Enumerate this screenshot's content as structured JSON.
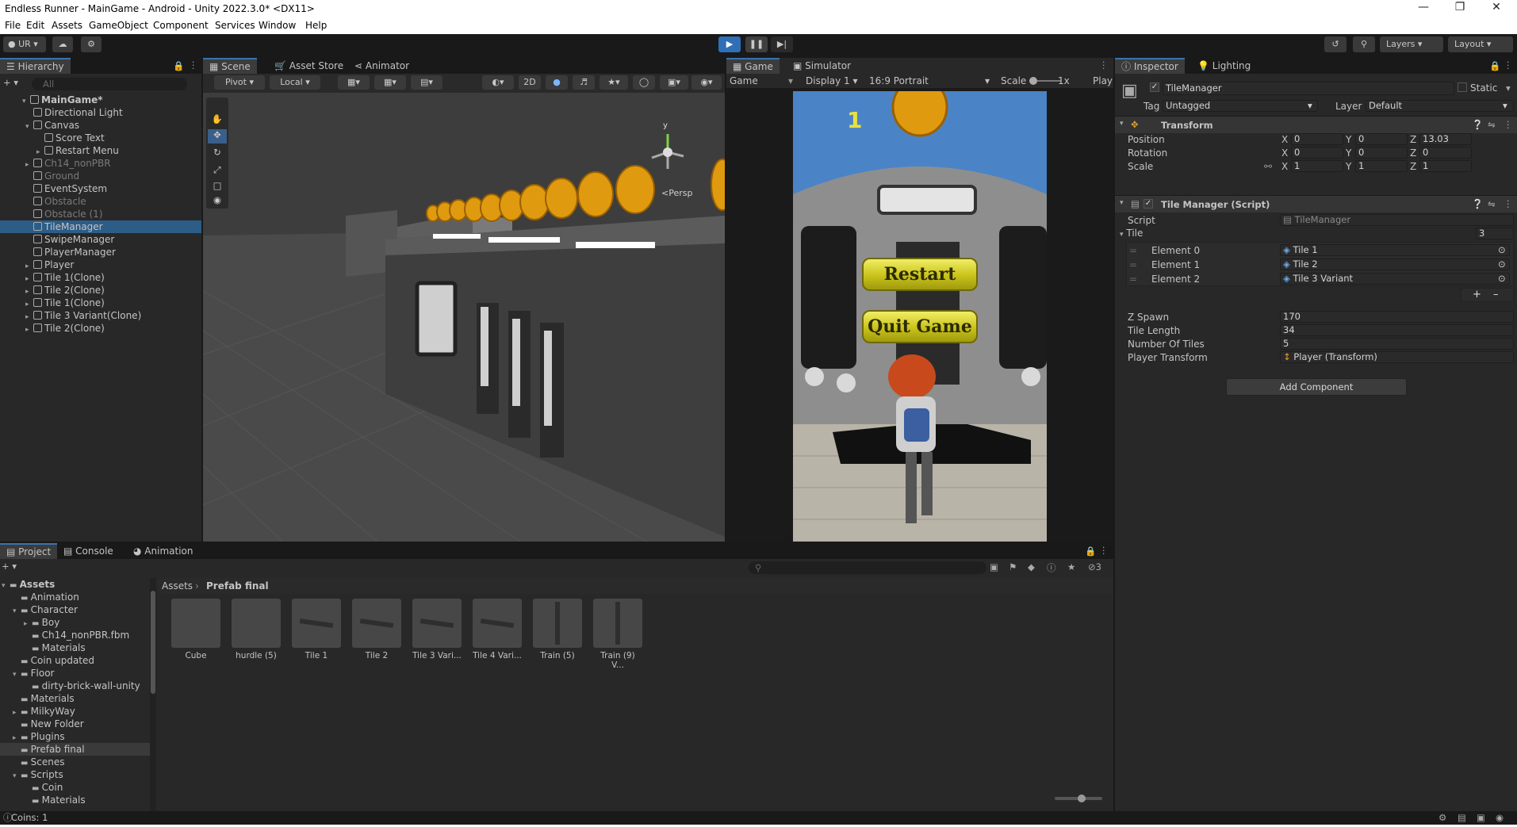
{
  "window": {
    "title": "Endless Runner - MainGame - Android - Unity 2022.3.0* <DX11>"
  },
  "menu": [
    "File",
    "Edit",
    "Assets",
    "GameObject",
    "Component",
    "Services",
    "Window",
    "Help"
  ],
  "toolbar": {
    "account": "UR",
    "layers": "Layers",
    "layout": "Layout"
  },
  "hierarchy": {
    "tab": "Hierarchy",
    "search_placeholder": "All",
    "scene": "MainGame*",
    "items": [
      {
        "label": "Directional Light",
        "dim": false
      },
      {
        "label": "Canvas",
        "dim": false
      },
      {
        "label": "Score Text",
        "dim": false
      },
      {
        "label": "Restart Menu",
        "dim": false
      },
      {
        "label": "Ch14_nonPBR",
        "dim": true
      },
      {
        "label": "Ground",
        "dim": true
      },
      {
        "label": "EventSystem",
        "dim": false
      },
      {
        "label": "Obstacle",
        "dim": true
      },
      {
        "label": "Obstacle (1)",
        "dim": true
      },
      {
        "label": "TileManager",
        "dim": false
      },
      {
        "label": "SwipeManager",
        "dim": false
      },
      {
        "label": "PlayerManager",
        "dim": false
      },
      {
        "label": "Player",
        "dim": false
      },
      {
        "label": "Tile 1(Clone)",
        "dim": false
      },
      {
        "label": "Tile 2(Clone)",
        "dim": false
      },
      {
        "label": "Tile 1(Clone)",
        "dim": false
      },
      {
        "label": "Tile 3 Variant(Clone)",
        "dim": false
      },
      {
        "label": "Tile 2(Clone)",
        "dim": false
      }
    ]
  },
  "scene_view": {
    "tabs": [
      "Scene",
      "Asset Store",
      "Animator"
    ],
    "pivot": "Pivot",
    "local": "Local",
    "mode_2d": "2D",
    "persp": "<Persp"
  },
  "game_view": {
    "tabs": [
      "Game",
      "Simulator"
    ],
    "mode": "Game",
    "display": "Display 1",
    "aspect": "16:9 Portrait",
    "scale_label": "Scale",
    "scale_value": "1x",
    "play_label": "Play",
    "score": "1",
    "restart": "Restart",
    "quit": "Quit Game"
  },
  "inspector": {
    "tabs": [
      "Inspector",
      "Lighting"
    ],
    "object_name": "TileManager",
    "static_label": "Static",
    "tag_label": "Tag",
    "tag": "Untagged",
    "layer_label": "Layer",
    "layer": "Default",
    "transform": {
      "title": "Transform",
      "position": {
        "label": "Position",
        "x": "0",
        "y": "0",
        "z": "13.03"
      },
      "rotation": {
        "label": "Rotation",
        "x": "0",
        "y": "0",
        "z": "0"
      },
      "scale": {
        "label": "Scale",
        "x": "1",
        "y": "1",
        "z": "1"
      }
    },
    "script": {
      "title": "Tile Manager (Script)",
      "script_label": "Script",
      "script_value": "TileManager",
      "tile_label": "Tile",
      "tile_count": "3",
      "elements": [
        {
          "label": "Element 0",
          "value": "Tile 1"
        },
        {
          "label": "Element 1",
          "value": "Tile 2"
        },
        {
          "label": "Element 2",
          "value": "Tile 3 Variant"
        }
      ],
      "fields": [
        {
          "label": "Z Spawn",
          "value": "170"
        },
        {
          "label": "Tile Length",
          "value": "34"
        },
        {
          "label": "Number Of Tiles",
          "value": "5"
        },
        {
          "label": "Player Transform",
          "value": "Player (Transform)"
        }
      ]
    },
    "add_component": "Add Component"
  },
  "project": {
    "tabs": [
      "Project",
      "Console",
      "Animation"
    ],
    "hidden_count": "3",
    "tree": [
      {
        "label": "Assets",
        "depth": 0,
        "bold": true
      },
      {
        "label": "Animation",
        "depth": 1
      },
      {
        "label": "Character",
        "depth": 1
      },
      {
        "label": "Boy",
        "depth": 2
      },
      {
        "label": "Ch14_nonPBR.fbm",
        "depth": 2
      },
      {
        "label": "Materials",
        "depth": 2
      },
      {
        "label": "Coin updated",
        "depth": 1
      },
      {
        "label": "Floor",
        "depth": 1
      },
      {
        "label": "dirty-brick-wall-unity",
        "depth": 2
      },
      {
        "label": "Materials",
        "depth": 1
      },
      {
        "label": "MilkyWay",
        "depth": 1
      },
      {
        "label": "New Folder",
        "depth": 1
      },
      {
        "label": "Plugins",
        "depth": 1
      },
      {
        "label": "Prefab final",
        "depth": 1,
        "selected": true
      },
      {
        "label": "Scenes",
        "depth": 1
      },
      {
        "label": "Scripts",
        "depth": 1
      },
      {
        "label": "Coin",
        "depth": 2
      },
      {
        "label": "Materials",
        "depth": 2
      }
    ],
    "breadcrumb": [
      "Assets",
      "Prefab final"
    ],
    "assets": [
      "Cube",
      "hurdle (5)",
      "Tile 1",
      "Tile 2",
      "Tile 3 Vari...",
      "Tile 4 Vari...",
      "Train (5)",
      "Train (9) V..."
    ]
  },
  "status": {
    "text": "Coins: 1"
  },
  "colors": {
    "accent": "#2c5d87",
    "play": "#2f6fb5",
    "sky": "#4a84c6",
    "button_yellow": "#d4d02a"
  }
}
